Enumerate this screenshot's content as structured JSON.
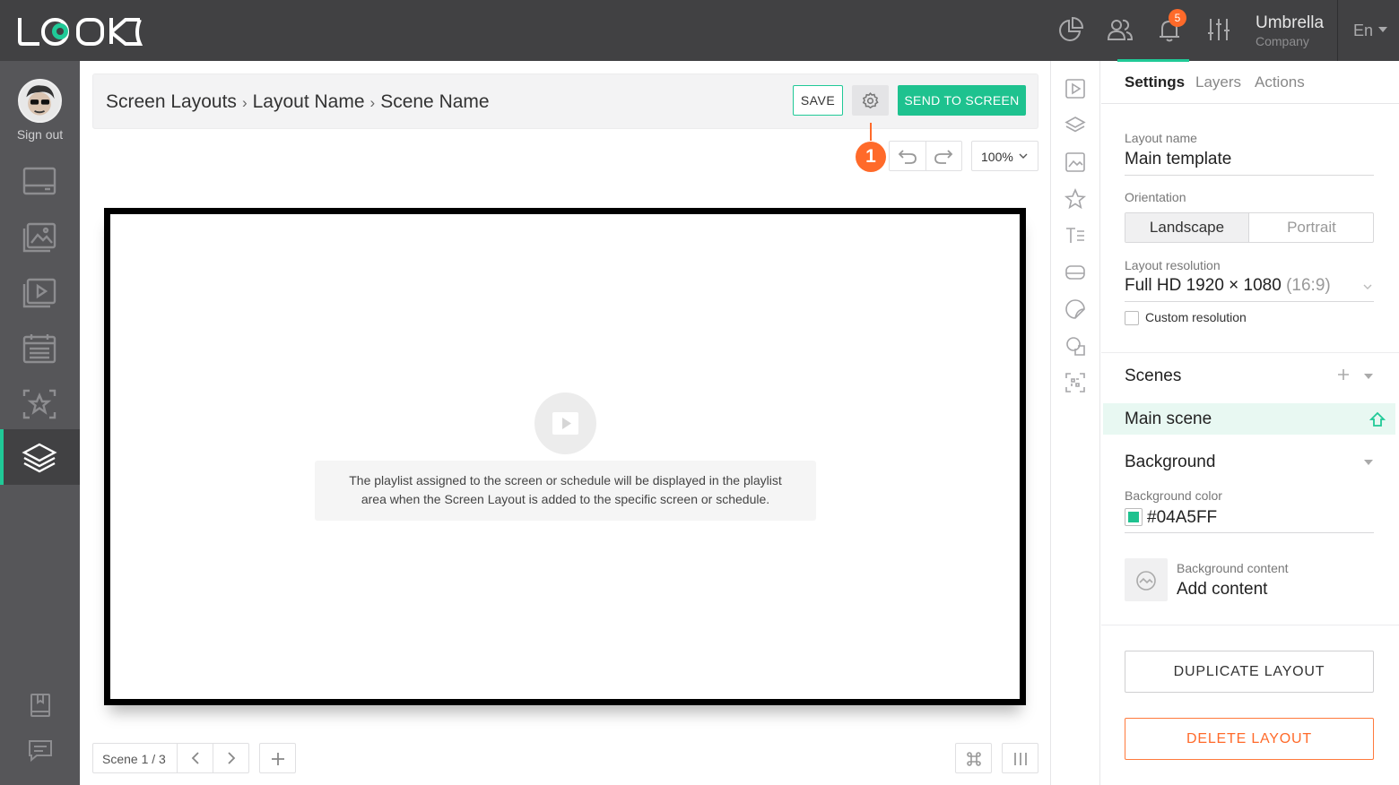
{
  "header": {
    "logo_text": "LOOK",
    "notifications_count": "5",
    "company_name": "Umbrella",
    "company_sub": "Company",
    "language": "En"
  },
  "sidebar": {
    "sign_out": "Sign out",
    "items": [
      {
        "icon": "screen-icon"
      },
      {
        "icon": "media-gallery-icon"
      },
      {
        "icon": "playlist-icon"
      },
      {
        "icon": "schedule-icon"
      },
      {
        "icon": "favorites-icon"
      },
      {
        "icon": "layers-icon",
        "active": true
      }
    ],
    "bottom": [
      {
        "icon": "book-icon"
      },
      {
        "icon": "chat-icon"
      }
    ]
  },
  "breadcrumb": {
    "items": [
      "Screen Layouts",
      "Layout Name",
      "Scene Name"
    ],
    "separator": "›"
  },
  "toolbar": {
    "save_label": "SAVE",
    "send_label": "SEND TO SCREEN",
    "zoom": "100%",
    "callout_number": "1"
  },
  "canvas": {
    "note_line1": "The playlist assigned to the screen or schedule will be displayed in the playlist",
    "note_line2": "area when the Screen Layout is added to the specific screen or schedule."
  },
  "bottom_bar": {
    "scene_label": "Scene 1 / 3"
  },
  "panel": {
    "tabs": [
      "Settings",
      "Layers",
      "Actions"
    ],
    "active_tab": "Settings",
    "layout_name_label": "Layout name",
    "layout_name_value": "Main template",
    "orientation_label": "Orientation",
    "orientation_options": [
      "Landscape",
      "Portrait"
    ],
    "orientation_selected": "Landscape",
    "resolution_label": "Layout resolution",
    "resolution_value": "Full HD 1920 × 1080",
    "resolution_ratio": "(16:9)",
    "custom_resolution_label": "Custom resolution",
    "custom_resolution_checked": false,
    "scenes_title": "Scenes",
    "main_scene": "Main scene",
    "background_title": "Background",
    "background_color_label": "Background color",
    "background_color_value": "#04A5FF",
    "background_content_label": "Background content",
    "background_content_value": "Add content",
    "duplicate_label": "DUPLICATE LAYOUT",
    "delete_label": "DELETE LAYOUT"
  },
  "colors": {
    "accent": "#1ec28f",
    "danger": "#ff6a2a",
    "topbar": "#414143",
    "sidebar": "#565659"
  }
}
